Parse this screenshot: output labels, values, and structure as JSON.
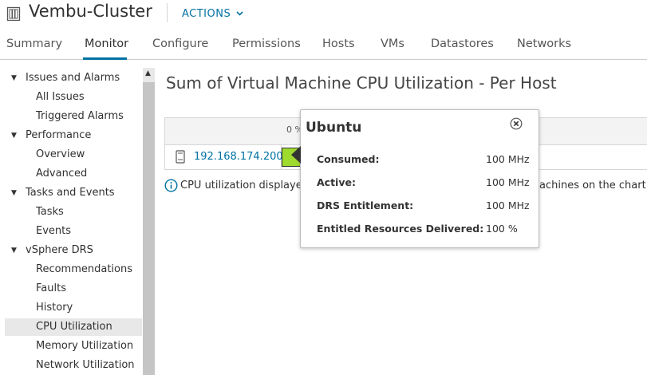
{
  "header": {
    "title": "Vembu-Cluster",
    "actions_label": "ACTIONS",
    "cluster_icon": "cluster-icon",
    "actions_icon": "chevron-down-icon"
  },
  "tabs": [
    {
      "label": "Summary"
    },
    {
      "label": "Monitor",
      "active": true
    },
    {
      "label": "Configure"
    },
    {
      "label": "Permissions"
    },
    {
      "label": "Hosts"
    },
    {
      "label": "VMs"
    },
    {
      "label": "Datastores"
    },
    {
      "label": "Networks"
    }
  ],
  "sidebar": {
    "groups": [
      {
        "label": "Issues and Alarms",
        "items": [
          "All Issues",
          "Triggered Alarms"
        ]
      },
      {
        "label": "Performance",
        "items": [
          "Overview",
          "Advanced"
        ]
      },
      {
        "label": "Tasks and Events",
        "items": [
          "Tasks",
          "Events"
        ]
      },
      {
        "label": "vSphere DRS",
        "items": [
          "Recommendations",
          "Faults",
          "History",
          "CPU Utilization",
          "Memory Utilization",
          "Network Utilization"
        ]
      }
    ],
    "selected": "CPU Utilization"
  },
  "main": {
    "title": "Sum of Virtual Machine CPU Utilization - Per Host",
    "table": {
      "header_pct": "0 %",
      "host": "192.168.174.200",
      "bar_color": "#9fdb2e"
    },
    "info_text": "CPU utilization displayed",
    "info_tail": "achines on the chart."
  },
  "tooltip": {
    "title": "Ubuntu",
    "rows": [
      {
        "label": "Consumed:",
        "value": "100 MHz"
      },
      {
        "label": "Active:",
        "value": "100 MHz"
      },
      {
        "label": "DRS Entitlement:",
        "value": "100 MHz"
      },
      {
        "label": "Entitled Resources Delivered:",
        "value": "100 %"
      }
    ]
  },
  "colors": {
    "accent": "#0072a3",
    "selected_bg": "#e8e8e8"
  }
}
